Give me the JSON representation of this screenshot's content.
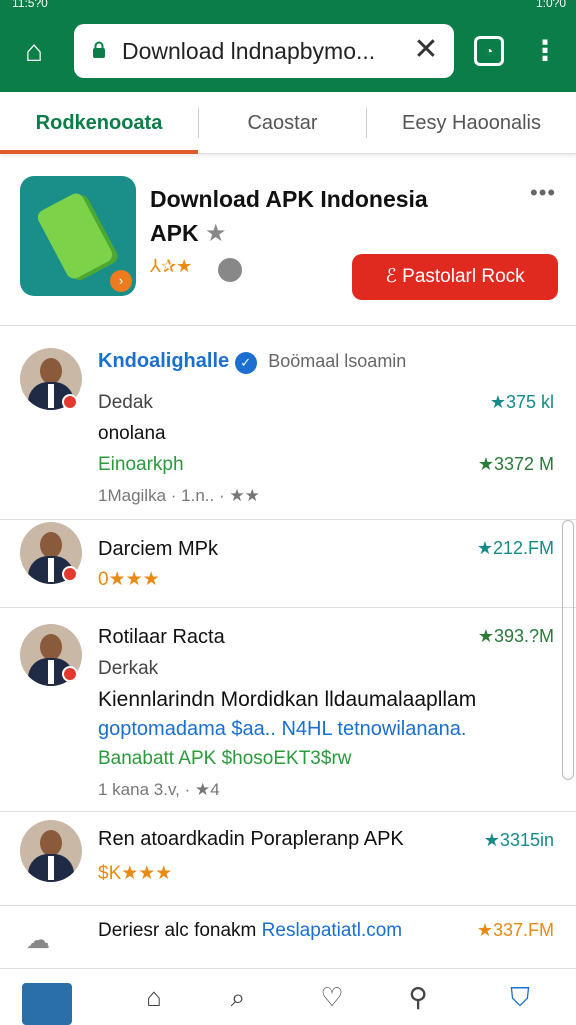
{
  "status": {
    "time": "11:5?0",
    "right": "1:0?0"
  },
  "browser": {
    "url": "Download lndnapbymo...",
    "icons": {
      "home": "home-icon",
      "lock": "lock-icon",
      "clear": "close-icon",
      "tabs": "tabs-icon",
      "menu": "more-vert-icon"
    }
  },
  "tabs": [
    {
      "label": "Rodkenooata"
    },
    {
      "label": "Caostar"
    },
    {
      "label": "Eesy Haoonalis"
    }
  ],
  "app": {
    "title_line1": "Download APK Indonesia",
    "title_line2": "APK",
    "title_star": "★",
    "rating_text": "⅄✰★",
    "install_label": "Pastolarl Rock",
    "more": "•••"
  },
  "reviews": [
    {
      "name": "Kndoalighalle",
      "verified": "✓",
      "subtitle": "Boömaal lsoamin",
      "lines": [
        "Dedak",
        "onolana",
        "Einoarkph"
      ],
      "footer": "1Magilka · 1.n.. · ★★",
      "scores": [
        "★375 kl",
        "★3372 M"
      ]
    },
    {
      "name": "Darciem MPk",
      "rating": "0★★★",
      "scores": [
        "★212.FM"
      ]
    },
    {
      "name": "Rotilaar Racta",
      "lines": [
        "Derkak",
        "Kiennlarindn Mordidkan lldaumalaapllam",
        "goptomadama $aa.. N4HL tetnowilanana.",
        "Banabatt APK $hosoEKT3$rw"
      ],
      "footer": "1 kana    3.v, · ★4",
      "scores": [
        "★393.?M"
      ]
    },
    {
      "name": "Ren atoardkadin Porapleranp APK",
      "rating": "$K★★★",
      "scores": [
        "★3315in"
      ]
    },
    {
      "name_plain": "Deriesr alc fonakm ",
      "name_link": "Reslapatiatl.com",
      "scores": [
        "★337.FM"
      ]
    }
  ],
  "bottom_nav": [
    "home-icon",
    "search-icon",
    "heart-icon",
    "profile-icon",
    "shopping-bag-icon"
  ],
  "colors": {
    "brand": "#0b7d48",
    "install": "#e02a1f",
    "tab_indicator": "#e05a2a",
    "link": "#1a6fd0",
    "green_text": "#2a9a3a",
    "teal_score": "#168a8a",
    "orange_score": "#e98a14"
  }
}
